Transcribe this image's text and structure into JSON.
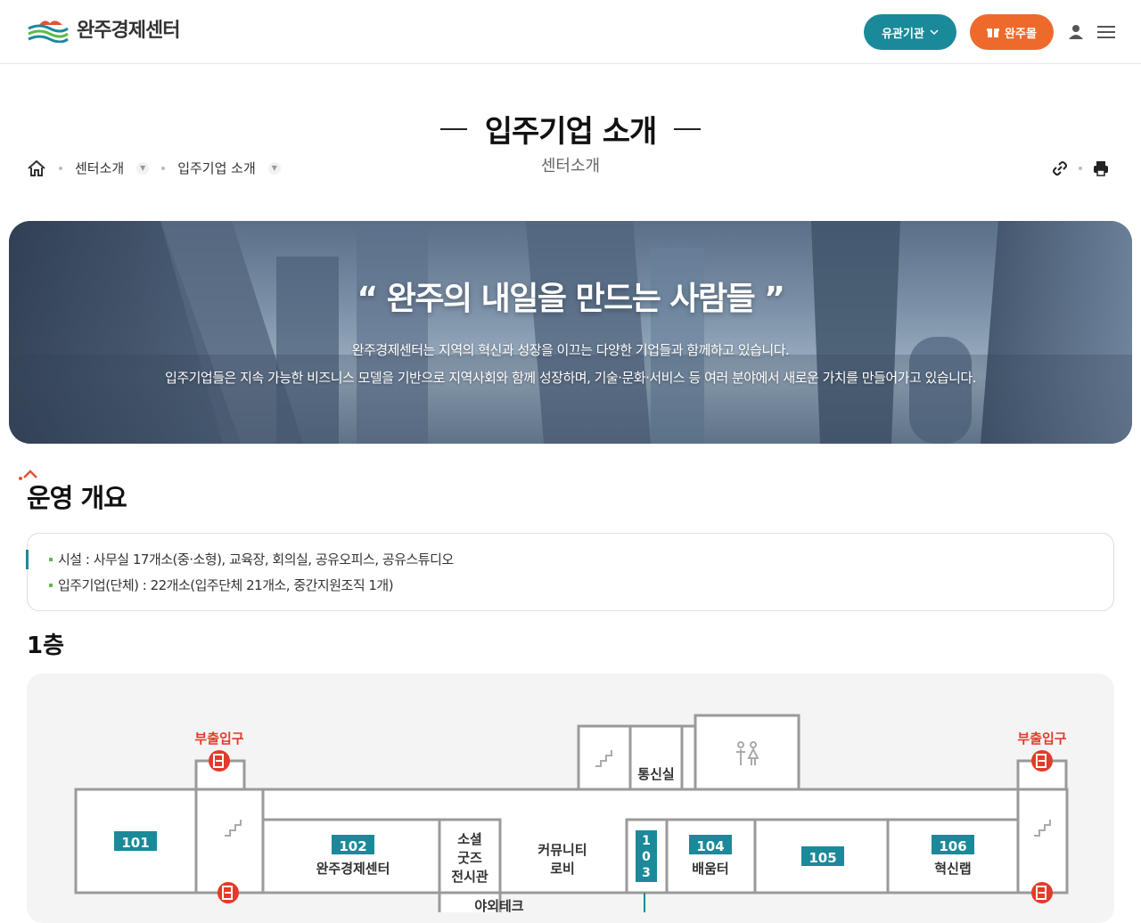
{
  "header": {
    "logo_text": "완주경제센터",
    "agency_button": "유관기관",
    "mall_button": "완주몰",
    "icons": [
      "user-icon",
      "menu-icon"
    ]
  },
  "page": {
    "title": "입주기업 소개",
    "subtitle": "센터소개"
  },
  "breadcrumb": {
    "home_icon": "home-icon",
    "items": [
      "센터소개",
      "입주기업 소개"
    ]
  },
  "tools": {
    "icons": [
      "link-icon",
      "print-icon"
    ]
  },
  "banner": {
    "quote": "“ 완주의 내일을 만드는 사람들 ”",
    "line1": "완주경제센터는 지역의 혁신과 성장을 이끄는 다양한 기업들과 함께하고 있습니다.",
    "line2": "입주기업들은 지속 가능한 비즈니스 모델을 기반으로 지역사회와 함께 성장하며, 기술·문화·서비스 등 여러 분야에서 새로운 가치를 만들어가고 있습니다."
  },
  "overview": {
    "title": "운영 개요",
    "items": [
      "시설 : 사무실 17개소(중·소형), 교육장, 회의실, 공유오피스, 공유스튜디오",
      "입주기업(단체) : 22개소(입주단체 21개소, 중간지원조직 1개)"
    ]
  },
  "floor": {
    "title": "1층",
    "labels": {
      "exit": "부출입구",
      "telecom": "통신실",
      "community": [
        "커뮤니티",
        "로비"
      ],
      "social": [
        "소셜",
        "굿즈",
        "전시관"
      ],
      "bottom_cut": "야외테크"
    },
    "rooms": [
      {
        "num": "101",
        "name": ""
      },
      {
        "num": "102",
        "name": "완주경제센터"
      },
      {
        "num": "103",
        "name": ""
      },
      {
        "num": "104",
        "name": "배움터"
      },
      {
        "num": "105",
        "name": ""
      },
      {
        "num": "106",
        "name": "혁신랩"
      }
    ]
  },
  "colors": {
    "teal": "#1a8a9a",
    "orange": "#ee6a2c",
    "exit_red": "#e23b2a"
  }
}
